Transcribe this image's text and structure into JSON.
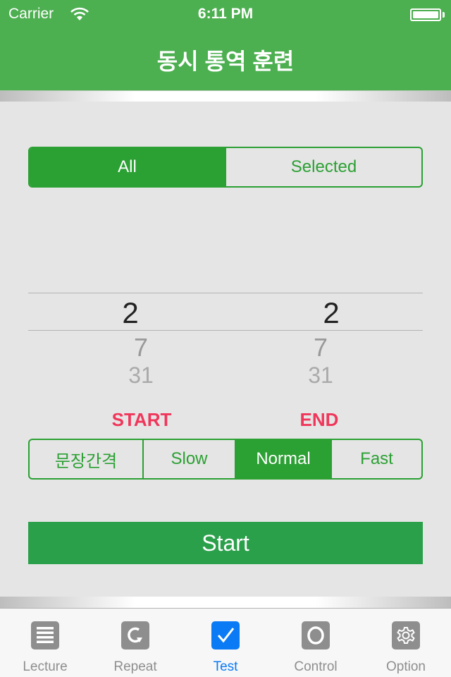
{
  "status_bar": {
    "carrier": "Carrier",
    "time": "6:11 PM",
    "battery_level": 1.0
  },
  "nav": {
    "title": "동시 통역 훈련"
  },
  "scope_segment": {
    "items": [
      {
        "label": "All",
        "selected": true
      },
      {
        "label": "Selected",
        "selected": false
      }
    ]
  },
  "picker": {
    "start": {
      "selected": "2",
      "below": [
        "7",
        "31"
      ]
    },
    "end": {
      "selected": "2",
      "below": [
        "7",
        "31"
      ]
    }
  },
  "range_labels": {
    "start": "START",
    "end": "END"
  },
  "speed_segment": {
    "items": [
      {
        "label": "문장간격",
        "selected": false
      },
      {
        "label": "Slow",
        "selected": false
      },
      {
        "label": "Normal",
        "selected": true
      },
      {
        "label": "Fast",
        "selected": false
      }
    ]
  },
  "start_button": {
    "label": "Start"
  },
  "colors": {
    "header_green": "#4caf50",
    "accent_green": "#2ba033",
    "label_red": "#f0365a",
    "tab_active_blue": "#0a7bf5",
    "tab_inactive_gray": "#8e8e8e"
  },
  "tabbar": {
    "items": [
      {
        "label": "Lecture",
        "icon": "list-icon",
        "active": false
      },
      {
        "label": "Repeat",
        "icon": "repeat-icon",
        "active": false
      },
      {
        "label": "Test",
        "icon": "checkbox-icon",
        "active": true
      },
      {
        "label": "Control",
        "icon": "circle-icon",
        "active": false
      },
      {
        "label": "Option",
        "icon": "gear-icon",
        "active": false
      }
    ]
  }
}
